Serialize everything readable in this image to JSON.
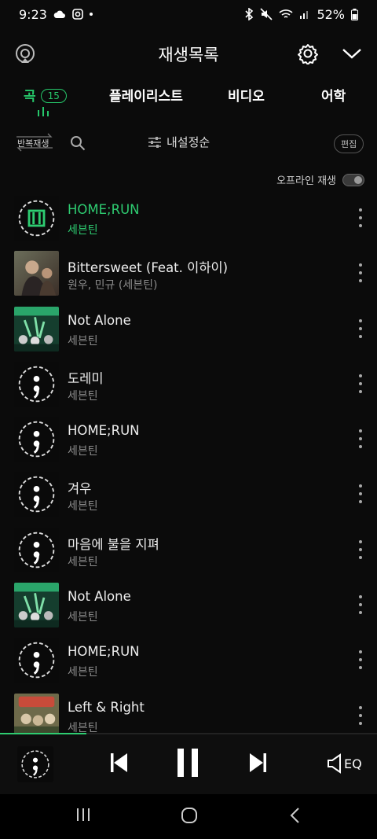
{
  "status_bar": {
    "time": "9:23",
    "battery": "52%"
  },
  "header": {
    "title": "재생목록"
  },
  "tabs": [
    {
      "label": "곡",
      "badge": "15",
      "active": true
    },
    {
      "label": "플레이리스트"
    },
    {
      "label": "비디오"
    },
    {
      "label": "어학"
    }
  ],
  "toolbar": {
    "repeat_label": "반복재생",
    "sort_label": "내설정순",
    "edit_label": "편집"
  },
  "offline": {
    "label": "오프라인 재생",
    "enabled": false
  },
  "songs": [
    {
      "title": "HOME;RUN",
      "artist": "세븐틴",
      "art": "homerun-green",
      "current": true
    },
    {
      "title": "Bittersweet (Feat. 이하이)",
      "artist": "원우, 민규 (세븐틴)",
      "art": "bittersweet"
    },
    {
      "title": "Not Alone",
      "artist": "세븐틴",
      "art": "not-alone"
    },
    {
      "title": "도레미",
      "artist": "세븐틴",
      "art": "semicolon"
    },
    {
      "title": "HOME;RUN",
      "artist": "세븐틴",
      "art": "semicolon"
    },
    {
      "title": "겨우",
      "artist": "세븐틴",
      "art": "semicolon"
    },
    {
      "title": "마음에 불을 지펴",
      "artist": "세븐틴",
      "art": "semicolon"
    },
    {
      "title": "Not Alone",
      "artist": "세븐틴",
      "art": "not-alone"
    },
    {
      "title": "HOME;RUN",
      "artist": "세븐틴",
      "art": "semicolon"
    },
    {
      "title": "Left & Right",
      "artist": "세븐틴",
      "art": "left-right"
    }
  ],
  "player": {
    "progress": 0.23,
    "eq_label": "EQ"
  },
  "colors": {
    "accent": "#2ecc71",
    "background": "#0b0b0b"
  }
}
